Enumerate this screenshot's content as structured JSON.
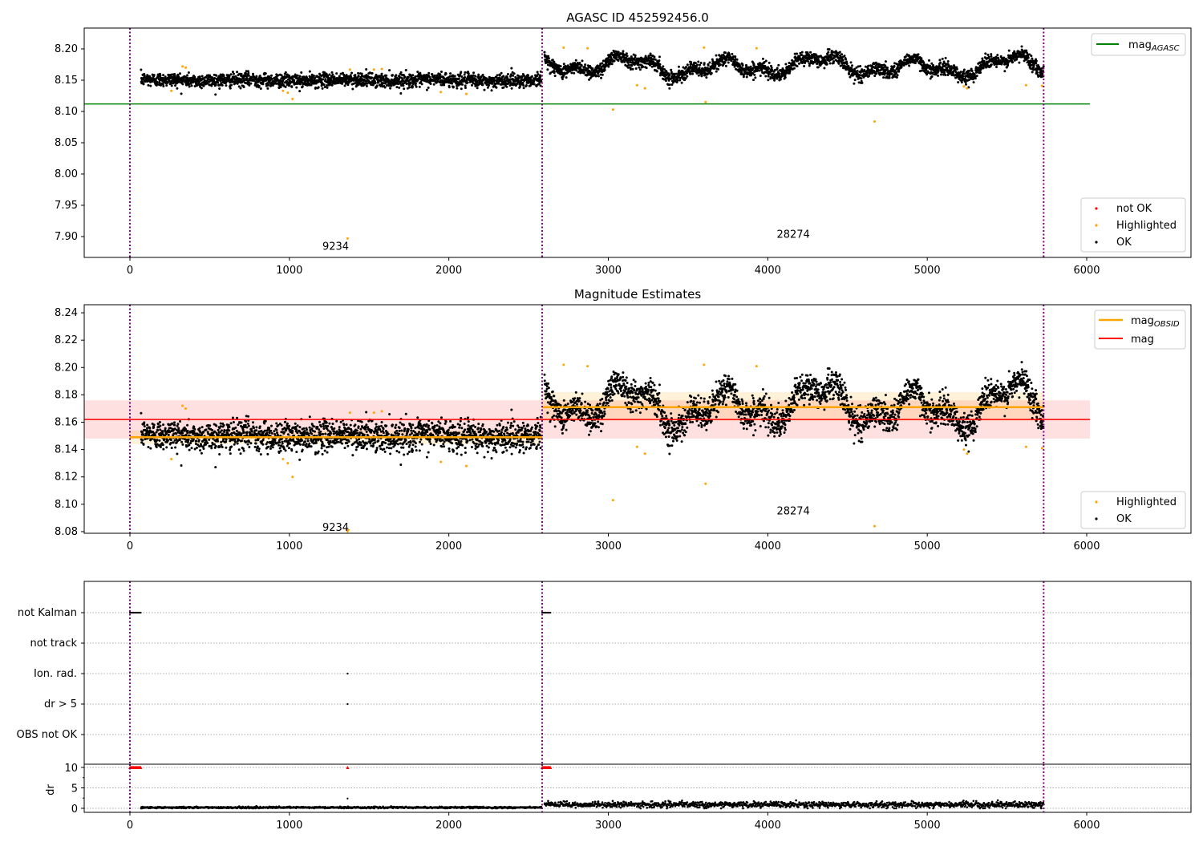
{
  "chart_data": [
    {
      "type": "scatter",
      "title": "AGASC ID 452592456.0",
      "xlim": [
        -287,
        6654
      ],
      "ylim": [
        7.8667,
        8.2333
      ],
      "xticks": [
        "0",
        "1000",
        "2000",
        "3000",
        "4000",
        "5000",
        "6000"
      ],
      "yticks": [
        "7.90",
        "7.95",
        "8.00",
        "8.05",
        "8.10",
        "8.15",
        "8.20"
      ],
      "lines": [
        {
          "name": "mag_AGASC",
          "label_main": "mag",
          "label_sub": "AGASC",
          "y": 8.112,
          "x": [
            -287,
            6020
          ],
          "color": "#008000"
        }
      ],
      "legend_markers": [
        {
          "name": "not OK",
          "color": "#ff0000"
        },
        {
          "name": "Highlighted",
          "color": "#ffa500"
        },
        {
          "name": "OK",
          "color": "#000000"
        }
      ],
      "annotations": [
        {
          "text": "9234",
          "x": 1290,
          "y": 7.884
        },
        {
          "text": "28274",
          "x": 4160,
          "y": 7.903
        }
      ]
    },
    {
      "type": "scatter",
      "title": "Magnitude Estimates",
      "xlim": [
        -287,
        6654
      ],
      "ylim": [
        8.0788,
        8.2459
      ],
      "xticks": [
        "0",
        "1000",
        "2000",
        "3000",
        "4000",
        "5000",
        "6000"
      ],
      "yticks": [
        "8.08",
        "8.10",
        "8.12",
        "8.14",
        "8.16",
        "8.18",
        "8.20",
        "8.22",
        "8.24"
      ],
      "lines": [
        {
          "name": "mag_OBSID",
          "label_main": "mag",
          "label_sub": "OBSID",
          "color": "#ffa500",
          "segments": [
            {
              "x": [
                0,
                2585
              ],
              "y": 8.149,
              "band": [
                8.144,
                8.154
              ]
            },
            {
              "x": [
                2585,
                5730
              ],
              "y": 8.171,
              "band": [
                8.161,
                8.182
              ]
            }
          ]
        },
        {
          "name": "mag",
          "label_main": "mag",
          "color": "#ff0000",
          "y": 8.162,
          "x": [
            -287,
            6020
          ],
          "band": [
            8.148,
            8.176
          ]
        }
      ],
      "legend_markers": [
        {
          "name": "Highlighted",
          "color": "#ffa500"
        },
        {
          "name": "OK",
          "color": "#000000"
        }
      ],
      "annotations": [
        {
          "text": "9234",
          "x": 1290,
          "y": 8.083
        },
        {
          "text": "28274",
          "x": 4160,
          "y": 8.095
        }
      ]
    },
    {
      "type": "scatter",
      "categories": [
        "not Kalman",
        "not track",
        "Ion. rad.",
        "dr > 5",
        "OBS not OK"
      ],
      "flags": [
        {
          "category": "not Kalman",
          "x_ranges": [
            [
              0,
              70
            ],
            [
              2585,
              2640
            ]
          ]
        },
        {
          "category": "Ion. rad.",
          "x": [
            1365
          ]
        },
        {
          "category": "dr > 5",
          "x": [
            1365
          ]
        }
      ]
    },
    {
      "type": "scatter",
      "ylabel": "dr",
      "ylim": [
        -0.98,
        10.78
      ],
      "yticks": [
        "0",
        "5",
        "10"
      ],
      "xticks": [
        "0",
        "1000",
        "2000",
        "3000",
        "4000",
        "5000",
        "6000"
      ],
      "clipped_red": {
        "y": 10,
        "x_ranges": [
          [
            0,
            70
          ],
          [
            2585,
            2640
          ]
        ],
        "x": [
          1365
        ]
      },
      "segments": [
        {
          "x": [
            70,
            2580
          ],
          "mean": 0.2,
          "std": 0.1
        },
        {
          "x": [
            2600,
            5730
          ],
          "mean": 0.9,
          "std": 0.35
        }
      ],
      "extra_points": [
        {
          "x": 1365,
          "y": 2.4
        }
      ]
    }
  ],
  "observations": {
    "boundaries": [
      0,
      2585,
      5730
    ],
    "segments": [
      {
        "x": [
          70,
          2580
        ],
        "mean": 8.15,
        "std": 0.0055,
        "wave": 0.001
      },
      {
        "x": [
          2600,
          5730
        ],
        "mean": 8.172,
        "std": 0.0055,
        "wave": 0.011
      }
    ],
    "highlighted": [
      [
        260,
        8.133
      ],
      [
        330,
        8.172
      ],
      [
        350,
        8.17
      ],
      [
        960,
        8.133
      ],
      [
        990,
        8.13
      ],
      [
        1020,
        8.12
      ],
      [
        1365,
        7.897
      ],
      [
        1380,
        8.167
      ],
      [
        1530,
        8.167
      ],
      [
        1580,
        8.168
      ],
      [
        1950,
        8.131
      ],
      [
        2110,
        8.128
      ],
      [
        2720,
        8.202
      ],
      [
        2870,
        8.201
      ],
      [
        3030,
        8.103
      ],
      [
        3180,
        8.142
      ],
      [
        3230,
        8.137
      ],
      [
        3600,
        8.202
      ],
      [
        3610,
        8.115
      ],
      [
        3930,
        8.201
      ],
      [
        4670,
        8.084
      ],
      [
        5230,
        8.14
      ],
      [
        5250,
        8.137
      ],
      [
        5620,
        8.142
      ],
      [
        5720,
        8.141
      ]
    ]
  },
  "colors": {
    "boundary": "#800080",
    "ok": "#000000",
    "highlight": "#ffa500",
    "notok": "#ff0000"
  }
}
